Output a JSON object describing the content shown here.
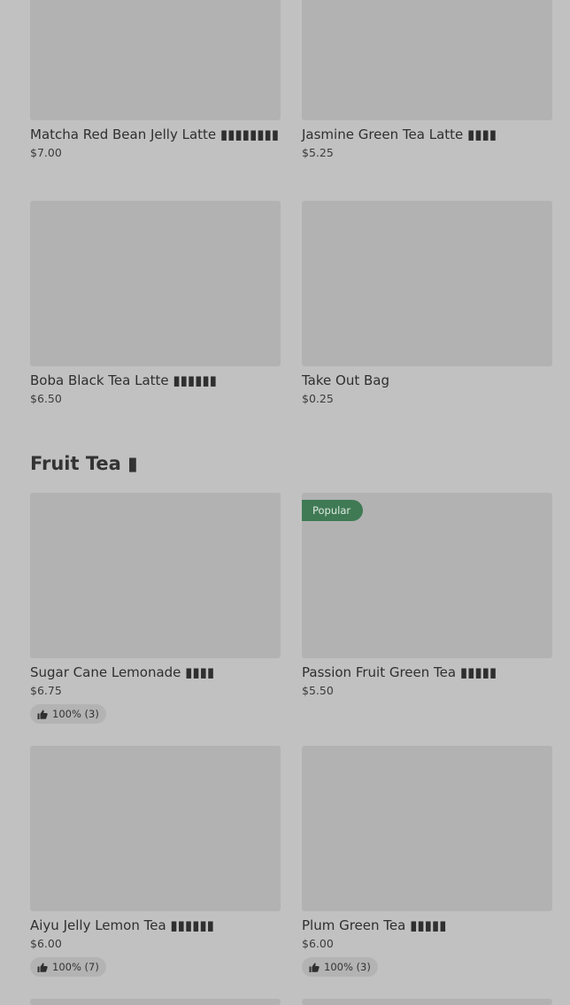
{
  "top_rows": [
    {
      "left": {
        "name": "Matcha Red Bean Jelly Latte ▮▮▮▮▮▮▮▮",
        "price": "$7.00"
      },
      "right": {
        "name": "Jasmine Green Tea Latte ▮▮▮▮",
        "price": "$5.25"
      }
    },
    {
      "left": {
        "name": "Boba Black Tea Latte ▮▮▮▮▮▮",
        "price": "$6.50"
      },
      "right": {
        "name": "Take Out Bag",
        "price": "$0.25"
      }
    }
  ],
  "fruit_section": {
    "title": "Fruit Tea ▮",
    "items": [
      {
        "name": "Sugar Cane Lemonade ▮▮▮▮",
        "price": "$6.75",
        "rating": "100% (3)"
      },
      {
        "name": "Passion Fruit Green Tea ▮▮▮▮▮",
        "price": "$5.50",
        "badge": "Popular"
      },
      {
        "name": "Aiyu Jelly Lemon Tea ▮▮▮▮▮▮",
        "price": "$6.00",
        "rating": "100% (7)"
      },
      {
        "name": "Plum Green Tea ▮▮▮▮▮",
        "price": "$6.00",
        "rating": "100% (3)"
      }
    ]
  },
  "colors": {
    "background": "#c1c1c1",
    "image_placeholder": "#b2b2b2",
    "popular_badge": "#3f7a55"
  },
  "icons": {
    "rating": "thumbs-up-icon"
  }
}
